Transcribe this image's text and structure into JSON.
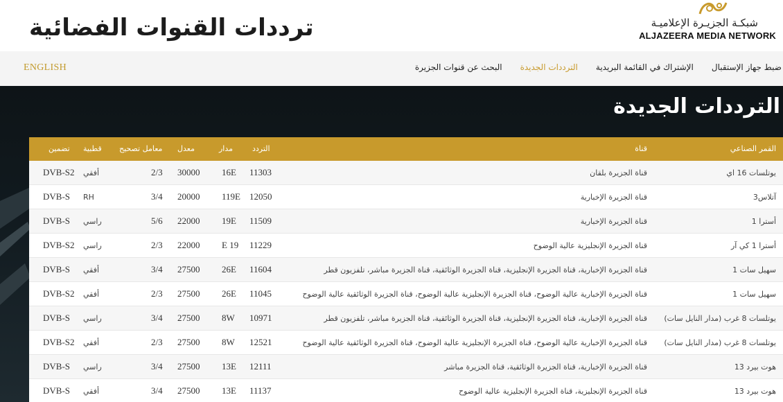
{
  "header": {
    "title": "ترددات القنوات الفضائية",
    "logo_ar": "شبكـة الجزيـرة الإعلاميـة",
    "logo_en": "ALJAZEERA MEDIA NETWORK"
  },
  "nav": {
    "english": "ENGLISH",
    "items": [
      {
        "label": "البحث عن قنوات الجزيرة"
      },
      {
        "label": "الترددات الجديدة"
      },
      {
        "label": "الإشتراك في القائمة البريدية"
      },
      {
        "label": "ضبط جهاز الإستقبال"
      }
    ]
  },
  "section": {
    "title": "الترددات الجديدة"
  },
  "colors": {
    "accent": "#c89a2c",
    "dark": "#111a1f"
  },
  "table": {
    "headers": {
      "satellite": "القمر الصناعي",
      "channel": "قناة",
      "frequency": "التردد",
      "orbit": "مدار",
      "rate": "معدل",
      "fec": "معامل تصحيح",
      "polarity": "قطبية",
      "modulation": "تضمين"
    },
    "rows": [
      {
        "satellite": "يوتلسات 16 اي",
        "channel": "قناة الجزيرة بلقان",
        "frequency": "11303",
        "orbit": "16E",
        "rate": "30000",
        "fec": "2/3",
        "polarity": "أفقي",
        "modulation": "DVB-S2"
      },
      {
        "satellite": "آتلاس3",
        "channel": "قناة الجزيرة الإخبارية",
        "frequency": "12050",
        "orbit": "119E",
        "rate": "20000",
        "fec": "3/4",
        "polarity": "RH",
        "modulation": "DVB-S"
      },
      {
        "satellite": "أسترا 1",
        "channel": "قناة الجزيرة الإخبارية",
        "frequency": "11509",
        "orbit": "19E",
        "rate": "22000",
        "fec": "5/6",
        "polarity": "راسي",
        "modulation": "DVB-S"
      },
      {
        "satellite": "أسترا 1 كي آر",
        "channel": "قناة الجزيرة الإنجليزية عالية الوضوح",
        "frequency": "11229",
        "orbit": "E 19",
        "rate": "22000",
        "fec": "2/3",
        "polarity": "راسي",
        "modulation": "DVB-S2"
      },
      {
        "satellite": "سهيل سات 1",
        "channel": "قناة الجزيرة الإخبارية، قناة الجزيرة الإنجليزية، قناة الجزيرة الوثائقية، قناة الجزيرة مباشر، تلفزيون قطر",
        "frequency": "11604",
        "orbit": "26E",
        "rate": "27500",
        "fec": "3/4",
        "polarity": "أفقي",
        "modulation": "DVB-S"
      },
      {
        "satellite": "سهيل سات 1",
        "channel": "قناة الجزيرة الإخبارية عالية الوضوح، قناة الجزيرة الإنجليزية عالية الوضوح، قناة الجزيرة الوثائقية عالية الوضوح",
        "frequency": "11045",
        "orbit": "26E",
        "rate": "27500",
        "fec": "2/3",
        "polarity": "أفقي",
        "modulation": "DVB-S2"
      },
      {
        "satellite": "يوتلسات 8 غرب (مدار النايل سات)",
        "channel": "قناة الجزيرة الإخبارية، قناة الجزيرة الإنجليزية، قناة الجزيرة الوثائقية، قناة الجزيرة مباشر، تلفزيون قطر",
        "frequency": "10971",
        "orbit": "8W",
        "rate": "27500",
        "fec": "3/4",
        "polarity": "راسي",
        "modulation": "DVB-S"
      },
      {
        "satellite": "يوتلسات 8 غرب (مدار النايل سات)",
        "channel": "قناة الجزيرة الإخبارية عالية الوضوح، قناة الجزيرة الإنجليزية عالية الوضوح، قناة الجزيرة الوثائقية عالية الوضوح",
        "frequency": "12521",
        "orbit": "8W",
        "rate": "27500",
        "fec": "2/3",
        "polarity": "أفقي",
        "modulation": "DVB-S2"
      },
      {
        "satellite": "هوت بيرد 13",
        "channel": "قناة الجزيرة الإخبارية، قناة الجزيرة الوثائقية، قناة الجزيرة مباشر",
        "frequency": "12111",
        "orbit": "13E",
        "rate": "27500",
        "fec": "3/4",
        "polarity": "راسي",
        "modulation": "DVB-S"
      },
      {
        "satellite": "هوت بيرد 13",
        "channel": "قناة الجزيرة الإنجليزية، قناة الجزيرة الإنجليزية عالية الوضوح",
        "frequency": "11137",
        "orbit": "13E",
        "rate": "27500",
        "fec": "3/4",
        "polarity": "أفقي",
        "modulation": "DVB-S"
      }
    ]
  }
}
